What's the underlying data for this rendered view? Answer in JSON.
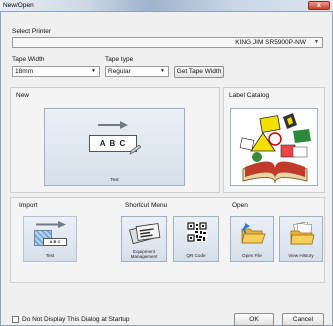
{
  "window": {
    "title": "New/Open",
    "close_glyph": "x"
  },
  "printer": {
    "label": "Select Printer",
    "value": "KING JIM SR5900P-NW"
  },
  "tape_width": {
    "label": "Tape Width",
    "value": "18mm"
  },
  "tape_type": {
    "label": "Tape type",
    "value": "Regular"
  },
  "get_tape_width": "Get Tape Width",
  "new_section": {
    "title": "New",
    "preview_text": "A B C",
    "tile_label": "Text"
  },
  "label_catalog": {
    "title": "Label Catalog"
  },
  "import_section": {
    "title": "Import",
    "tile_label": "Text",
    "preview_text": "A B C"
  },
  "shortcut_menu": {
    "title": "Shortcut Menu",
    "items": [
      {
        "label": "Equipment Management"
      },
      {
        "label": "QR Code"
      }
    ]
  },
  "open_section": {
    "title": "Open",
    "items": [
      {
        "label": "Open File"
      },
      {
        "label": "View History"
      }
    ]
  },
  "startup_checkbox": {
    "label": "Do Not Display This Dialog at Startup",
    "checked": false
  },
  "buttons": {
    "ok": "OK",
    "cancel": "Cancel"
  },
  "icons": {
    "close": "close-icon",
    "dropdown": "chevron-down-icon",
    "arrow": "arrow-right-icon",
    "label_catalog": "label-book-icon",
    "equipment": "equipment-labels-icon",
    "qr": "qr-code-icon",
    "open_file": "open-folder-icon",
    "history": "history-folder-icon"
  }
}
